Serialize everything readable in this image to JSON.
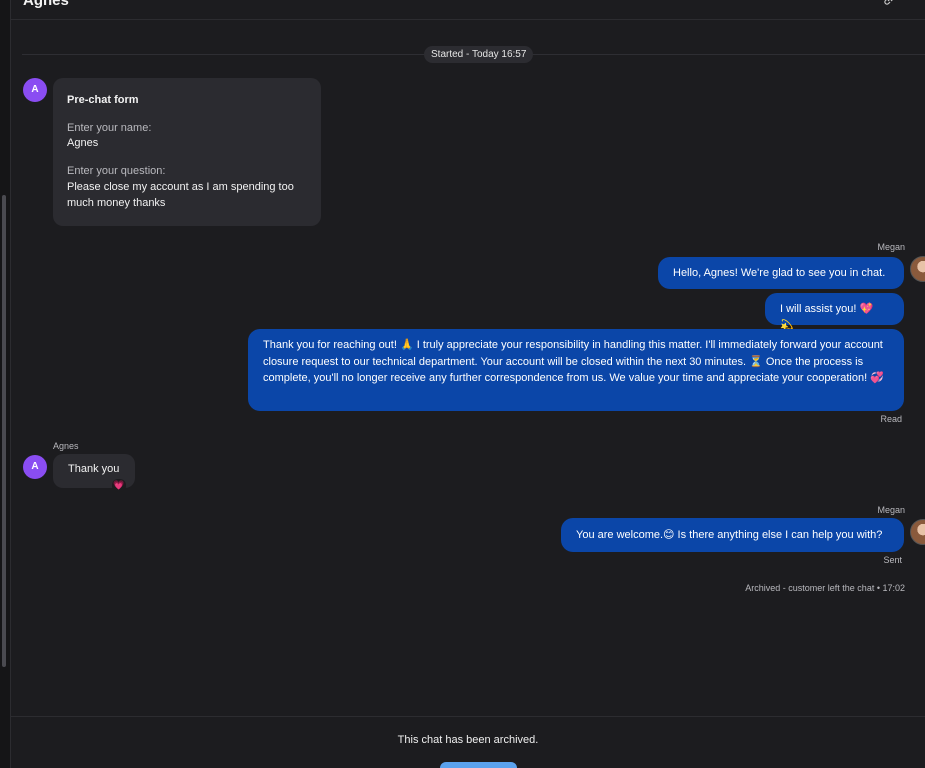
{
  "header": {
    "title": "Agnes",
    "icon": "link-icon"
  },
  "started_pill": "Started - Today 16:57",
  "prechat": {
    "avatar_letter": "A",
    "title": "Pre-chat form",
    "name_label": "Enter your name:",
    "name_value": "Agnes",
    "question_label": "Enter your question:",
    "question_value": "Please close my account as I am spending too much money thanks"
  },
  "messages": {
    "megan_label_1": "Megan",
    "agent_msg_1": "Hello, Agnes! We're glad to see you in chat.",
    "agent_msg_2": "I will assist you! 💖 💫",
    "agent_msg_3": "Thank you for reaching out! 🙏 I truly appreciate your responsibility in handling this matter. I'll immediately forward your account closure request to our technical department. Your account will be closed within the next 30 minutes.  ⏳  Once the process is complete, you'll no longer receive any further correspondence from us. We value your time and appreciate your cooperation! 💞",
    "read_status": "Read",
    "agnes_label": "Agnes",
    "customer_avatar_letter": "A",
    "customer_msg_1": "Thank you",
    "customer_reaction": "💗",
    "megan_label_2": "Megan",
    "agent_msg_4": "You are welcome.😊 Is there anything else I can help you with?",
    "sent_status": "Sent"
  },
  "archive_note": "Archived - customer left the chat • 17:02",
  "archived_message": "This chat has been archived."
}
